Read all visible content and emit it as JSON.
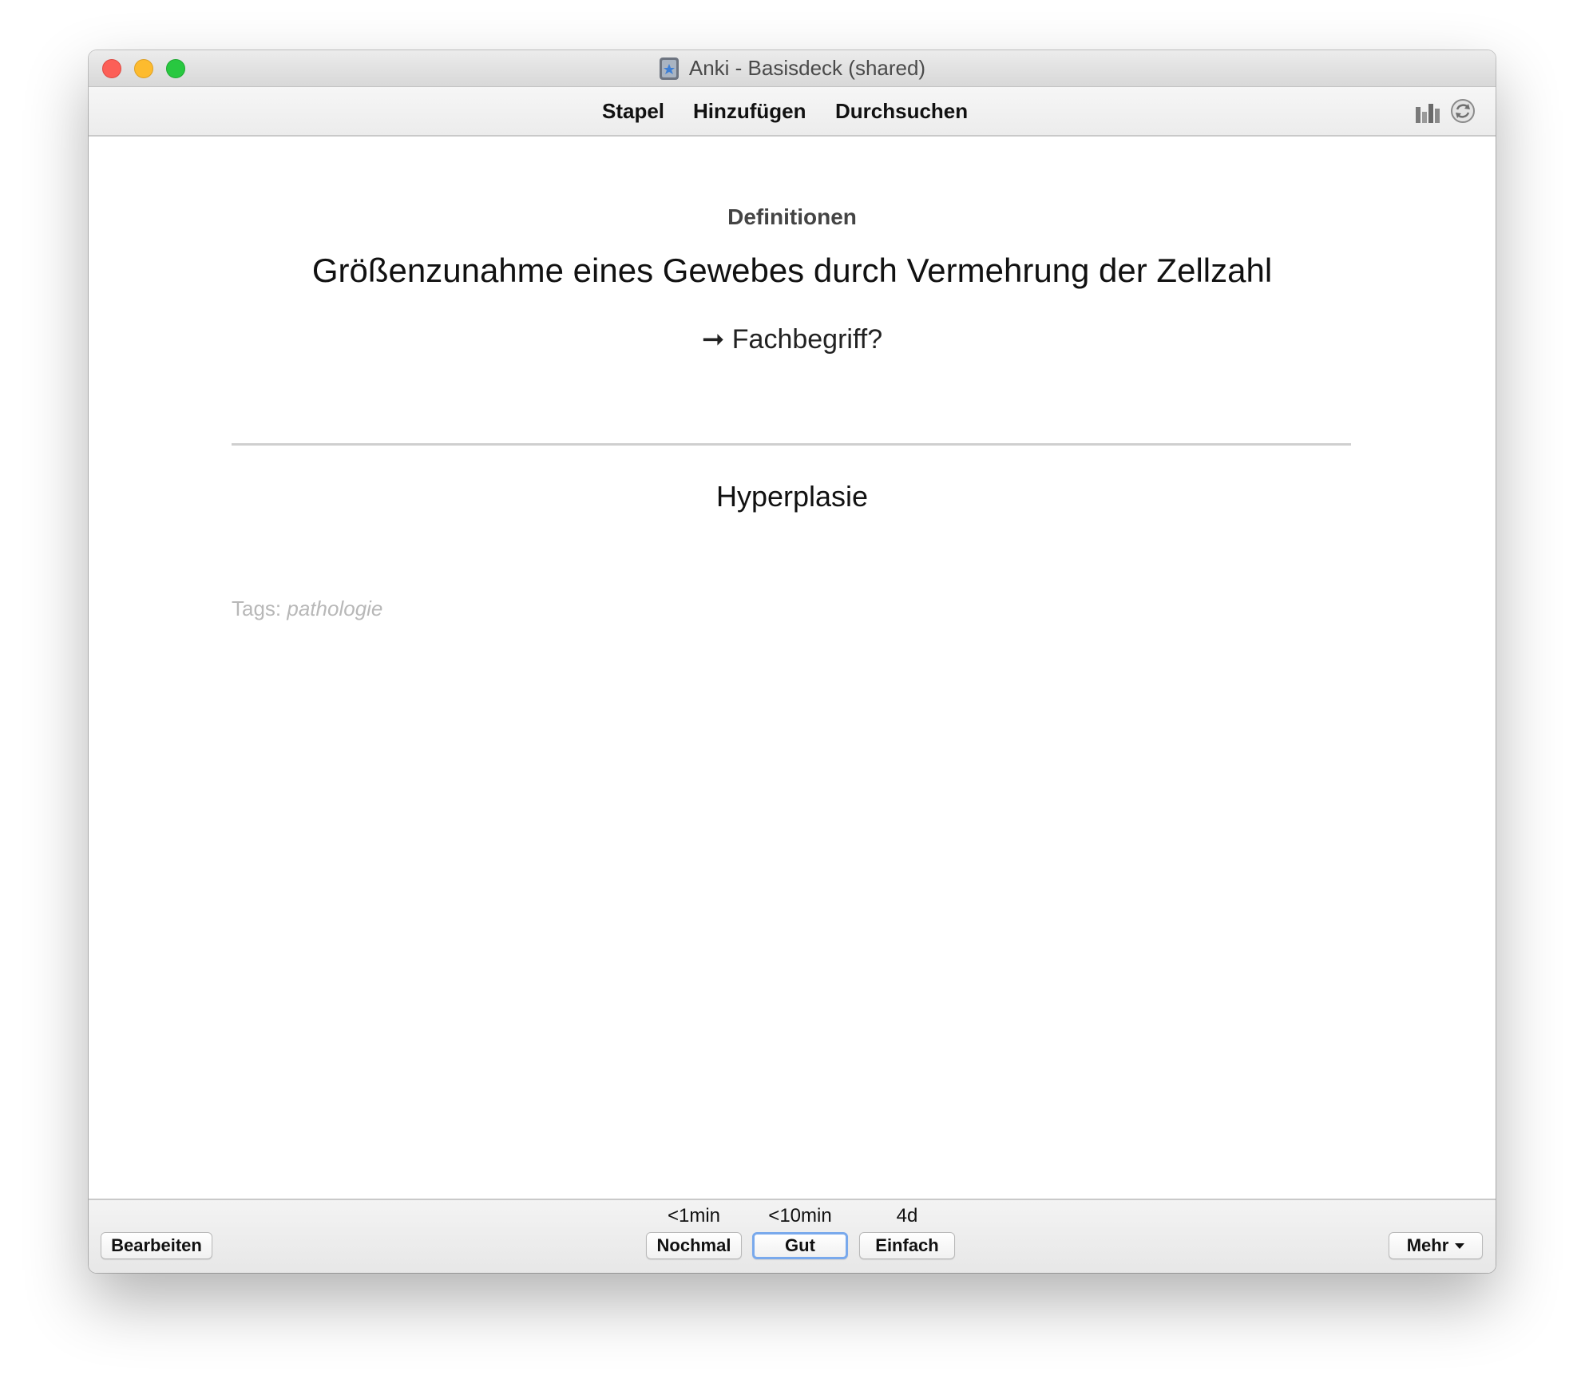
{
  "window": {
    "title": "Anki - Basisdeck (shared)"
  },
  "toolbar": {
    "decks_label": "Stapel",
    "add_label": "Hinzufügen",
    "browse_label": "Durchsuchen",
    "stats_icon": "stats-icon",
    "sync_icon": "sync-icon"
  },
  "card": {
    "deck_name": "Definitionen",
    "question": "Größenzunahme eines Gewebes durch Vermehrung der Zellzahl",
    "prompt": "➞ Fachbegriff?",
    "answer": "Hyperplasie",
    "tags_label": "Tags:",
    "tags_value": "pathologie"
  },
  "bottom": {
    "edit_label": "Bearbeiten",
    "answers": [
      {
        "interval": "<1min",
        "label": "Nochmal"
      },
      {
        "interval": "<10min",
        "label": "Gut"
      },
      {
        "interval": "4d",
        "label": "Einfach"
      }
    ],
    "more_label": "Mehr"
  },
  "colors": {
    "close": "#fc5f57",
    "minimize": "#fdbb2e",
    "zoom": "#28c840",
    "default_button_border": "#79a9ec"
  }
}
